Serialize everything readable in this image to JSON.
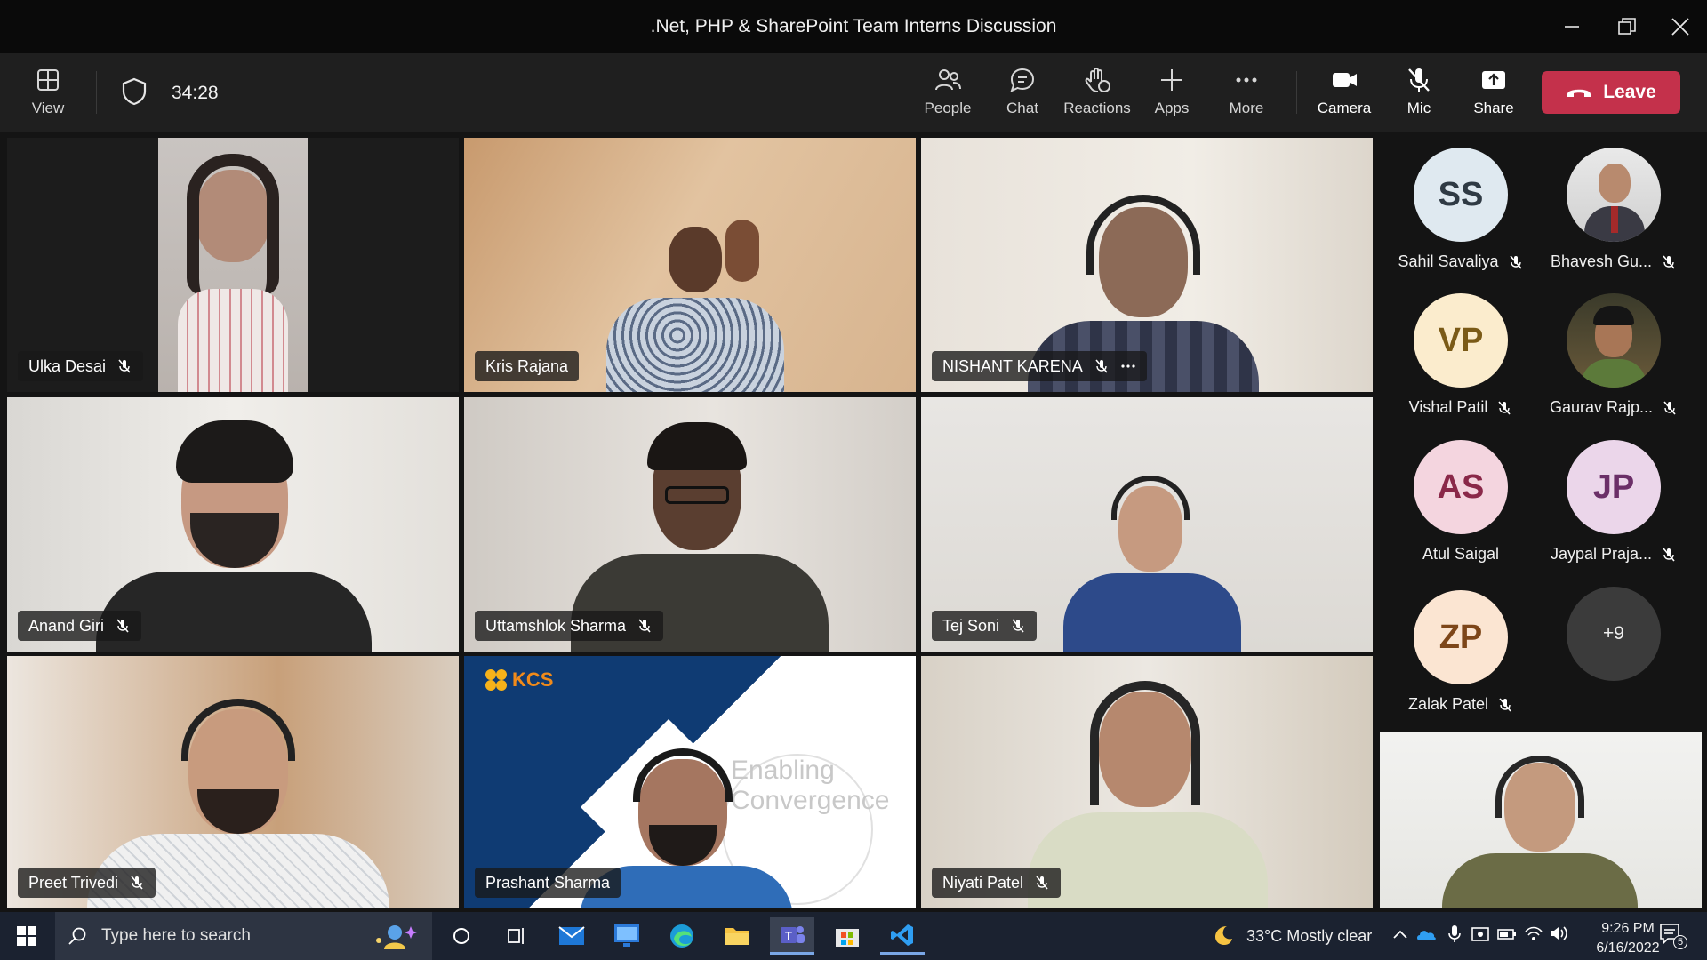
{
  "window": {
    "title": ".Net, PHP & SharePoint Team Interns Discussion"
  },
  "toolbar": {
    "view": "View",
    "timer": "34:28",
    "people": "People",
    "chat": "Chat",
    "reactions": "Reactions",
    "apps": "Apps",
    "more": "More",
    "camera": "Camera",
    "mic": "Mic",
    "share": "Share",
    "leave": "Leave"
  },
  "tiles": [
    {
      "name": "Ulka Desai"
    },
    {
      "name": "Kris Rajana"
    },
    {
      "name": "NISHANT KARENA"
    },
    {
      "name": "Anand Giri"
    },
    {
      "name": "Uttamshlok Sharma"
    },
    {
      "name": "Tej Soni"
    },
    {
      "name": "Preet Trivedi"
    },
    {
      "name": "Prashant Sharma"
    },
    {
      "name": "Niyati Patel"
    }
  ],
  "slide_logo_text": "KCS",
  "slide_text": [
    "Enabling",
    "Convergence"
  ],
  "roster": [
    {
      "initials": "SS",
      "name": "Sahil Savaliya",
      "bg": "#dfe9f0",
      "fg": "#2f3a44"
    },
    {
      "initials": "",
      "name": "Bhavesh Gu...",
      "bg": "#d9d9d9",
      "fg": "#333"
    },
    {
      "initials": "VP",
      "name": "Vishal Patil",
      "bg": "#fbeccd",
      "fg": "#7a5a17"
    },
    {
      "initials": "",
      "name": "Gaurav Rajp...",
      "bg": "#5b4a3a",
      "fg": "#fff"
    },
    {
      "initials": "AS",
      "name": "Atul Saigal",
      "bg": "#f4d5df",
      "fg": "#8a2849"
    },
    {
      "initials": "JP",
      "name": "Jaypal Praja...",
      "bg": "#ebd6ea",
      "fg": "#6b2f68"
    },
    {
      "initials": "ZP",
      "name": "Zalak Patel",
      "bg": "#fbe5d2",
      "fg": "#7d4619"
    }
  ],
  "overflow": "+9",
  "taskbar": {
    "search_placeholder": "Type here to search",
    "weather": "33°C  Mostly clear",
    "time": "9:26 PM",
    "date": "6/16/2022",
    "notifications": "5"
  }
}
